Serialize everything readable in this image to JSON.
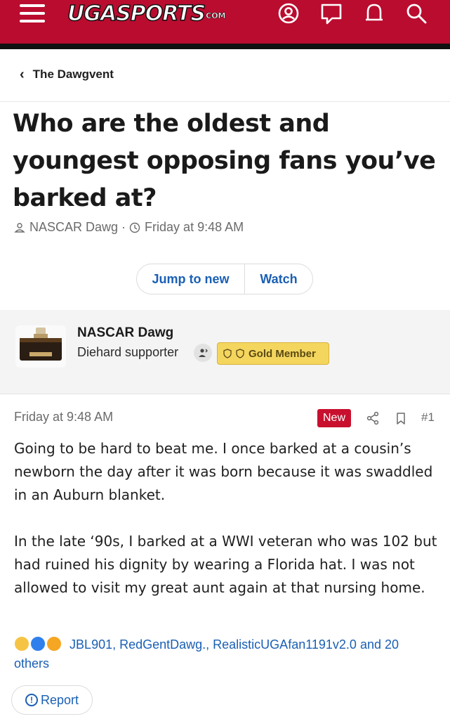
{
  "header": {
    "logo_main": "UGASPORTS",
    "logo_suffix": "COM",
    "colors": {
      "brand_red": "#ba0c2f",
      "bar_black": "#111111"
    },
    "icons": [
      "menu-icon",
      "account-icon",
      "chat-icon",
      "alerts-icon",
      "search-icon"
    ]
  },
  "breadcrumb": {
    "label": "The Dawgvent"
  },
  "thread": {
    "title": "Who are the oldest and youngest opposing fans you’ve barked at?",
    "author": "NASCAR Dawg",
    "separator": "·",
    "date": "Friday at 9:48 AM"
  },
  "actions": {
    "jump_label": "Jump to new",
    "watch_label": "Watch"
  },
  "post": {
    "author": "NASCAR Dawg",
    "role": "Diehard supporter",
    "badge": "Gold Member",
    "date": "Friday at 9:48 AM",
    "new_label": "New",
    "number": "#1",
    "paragraphs": [
      "Going to be hard to beat me. I once barked at a cousin’s newborn the day after it was born because it was swaddled in an Auburn blanket.",
      "In the late ‘90s, I barked at a WWI veteran who was 102 but had ruined his dignity by wearing a Florida hat. I was not allowed to visit my great aunt again at that nursing home."
    ],
    "reactions_text": "JBL901, RedGentDawg., RealisticUGAfan1191v2.0 and 20 others",
    "report_label": "Report"
  }
}
